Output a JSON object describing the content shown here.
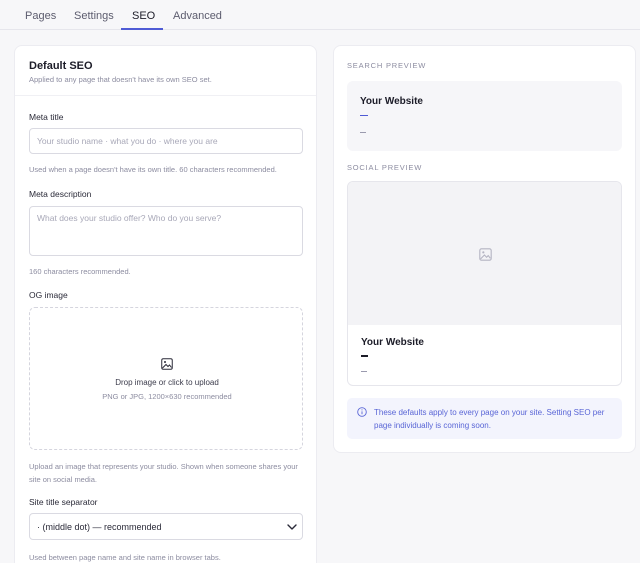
{
  "tabs": [
    {
      "label": "Pages"
    },
    {
      "label": "Settings"
    },
    {
      "label": "SEO"
    },
    {
      "label": "Advanced"
    }
  ],
  "active_tab": "SEO",
  "default_seo": {
    "title": "Default SEO",
    "subtitle": "Applied to any page that doesn't have its own SEO set.",
    "meta_title": {
      "label": "Meta title",
      "value": "",
      "placeholder": "Your studio name · what you do · where you are",
      "hint": "Used when a page doesn't have its own title. 60 characters recommended."
    },
    "meta_description": {
      "label": "Meta description",
      "value": "",
      "placeholder": "What does your studio offer? Who do you serve?",
      "hint": "160 characters recommended."
    },
    "og_image": {
      "label": "OG image",
      "icon": "image-icon",
      "dropzone_title": "Drop image or click to upload",
      "dropzone_subtitle": "PNG or JPG, 1200×630 recommended",
      "hint": "Upload an image that represents your studio. Shown when someone shares your site on social media."
    },
    "separator": {
      "label": "Site title separator",
      "selected": "· (middle dot) — recommended",
      "icon": "chevron-down-icon",
      "hint": "Used between page name and site name in browser tabs."
    }
  },
  "search_preview": {
    "section_label": "SEARCH PREVIEW",
    "site_name": "Your Website"
  },
  "social_preview": {
    "section_label": "SOCIAL PREVIEW",
    "image_icon": "image-icon",
    "site_name": "Your Website"
  },
  "info": {
    "icon": "info-circle-icon",
    "text": "These defaults apply to every page on your site. Setting SEO per page individually is coming soon."
  },
  "colors": {
    "accent": "#4f5bd5",
    "info_background": "#f3f4fd",
    "page_background": "#f7f7f9"
  }
}
